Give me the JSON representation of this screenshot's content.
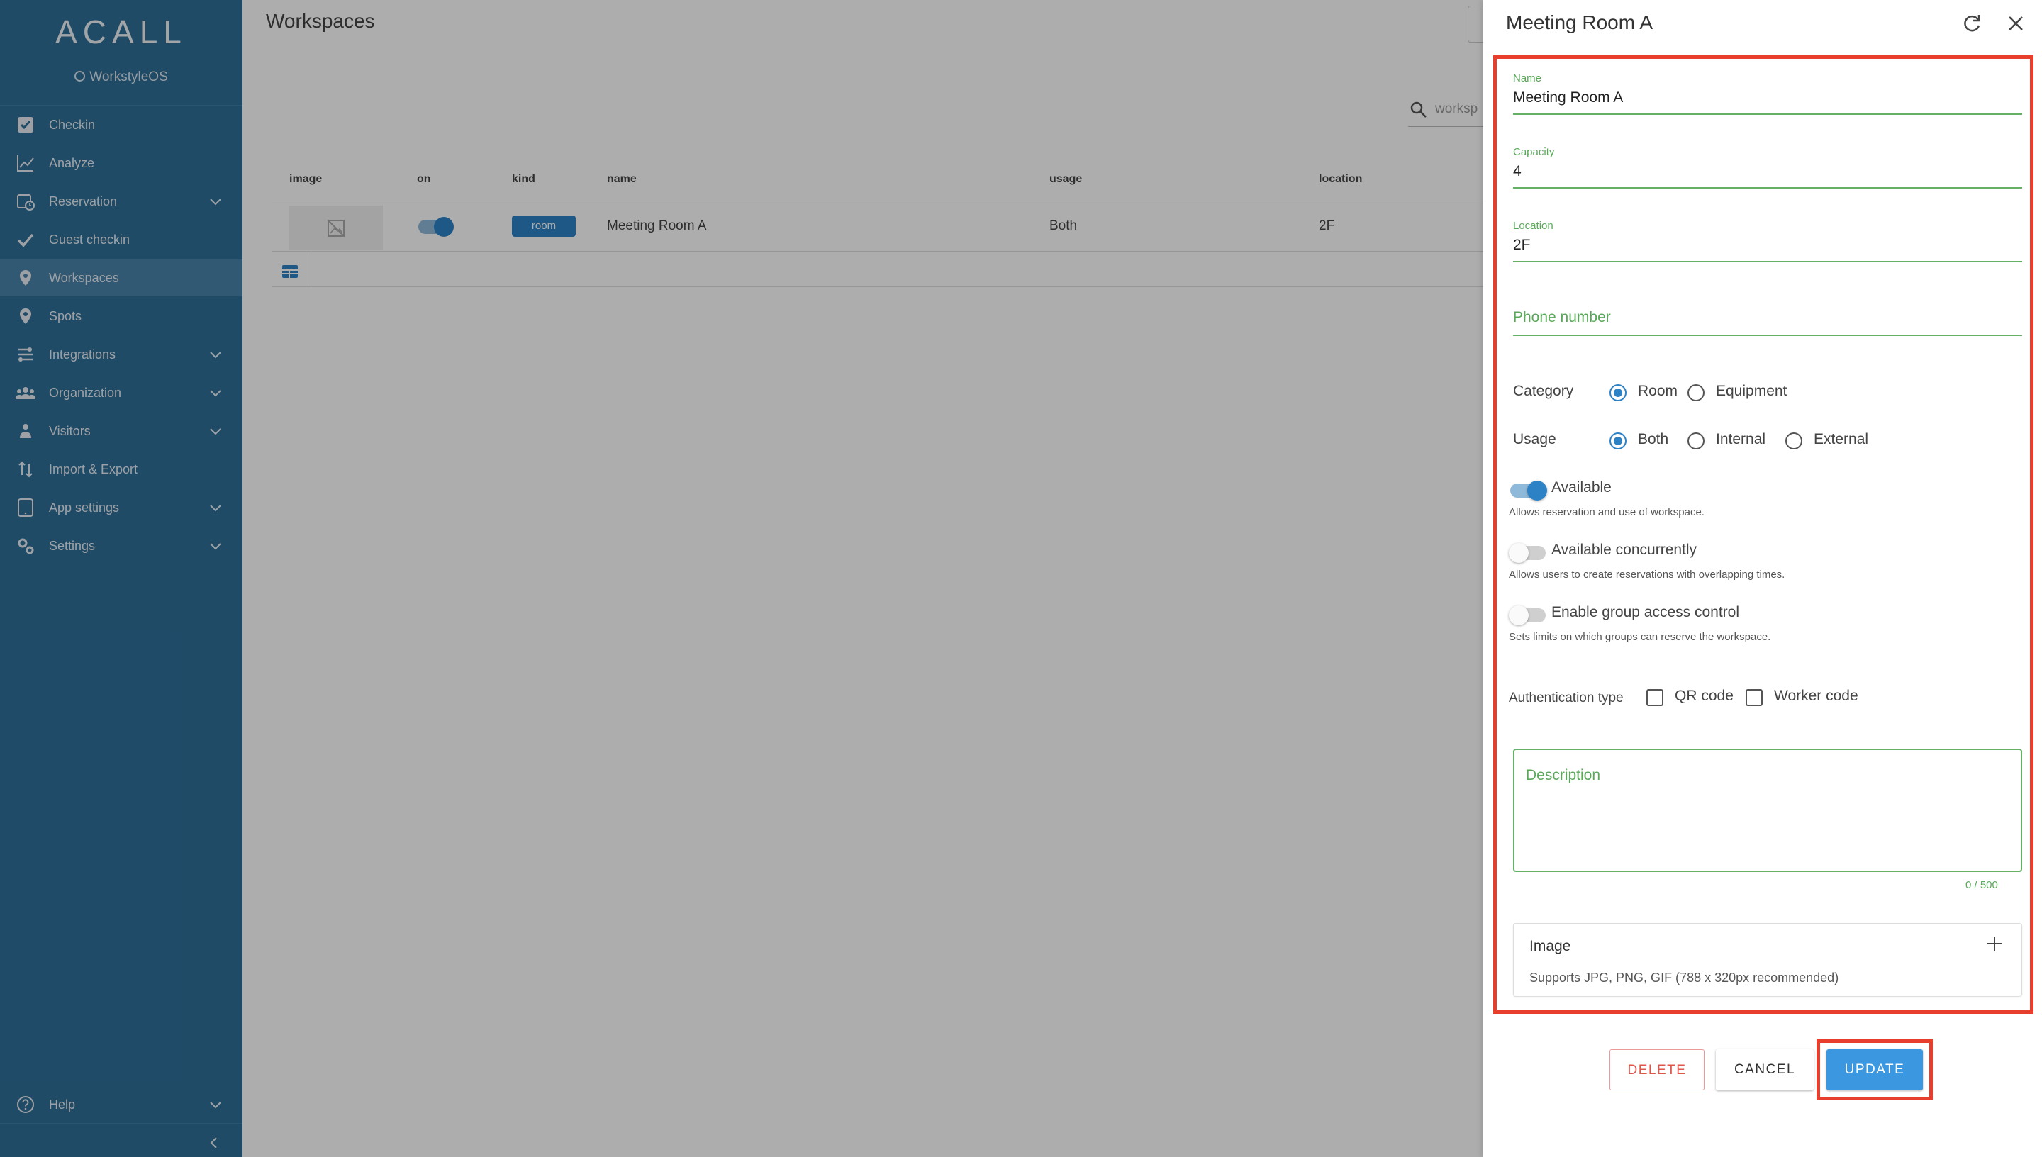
{
  "sidebar": {
    "logo": "ACALL",
    "product": "WorkstyleOS",
    "items": [
      {
        "label": "Checkin",
        "icon": "checkbox-icon",
        "expandable": false,
        "active": false
      },
      {
        "label": "Analyze",
        "icon": "chart-line-icon",
        "expandable": false,
        "active": false
      },
      {
        "label": "Reservation",
        "icon": "calendar-clock-icon",
        "expandable": true,
        "active": false
      },
      {
        "label": "Guest checkin",
        "icon": "check-icon",
        "expandable": false,
        "active": false
      },
      {
        "label": "Workspaces",
        "icon": "map-pin-icon",
        "expandable": false,
        "active": true
      },
      {
        "label": "Spots",
        "icon": "map-pin-dot-icon",
        "expandable": false,
        "active": false
      },
      {
        "label": "Integrations",
        "icon": "integrations-icon",
        "expandable": true,
        "active": false
      },
      {
        "label": "Organization",
        "icon": "people-icon",
        "expandable": true,
        "active": false
      },
      {
        "label": "Visitors",
        "icon": "visitor-icon",
        "expandable": true,
        "active": false
      },
      {
        "label": "Import & Export",
        "icon": "import-export-icon",
        "expandable": false,
        "active": false
      },
      {
        "label": "App settings",
        "icon": "tablet-icon",
        "expandable": true,
        "active": false
      },
      {
        "label": "Settings",
        "icon": "gears-icon",
        "expandable": true,
        "active": false
      }
    ],
    "help": {
      "label": "Help",
      "icon": "help-icon",
      "expandable": true
    }
  },
  "main": {
    "title": "Workspaces",
    "search_value": "worksp",
    "columns": [
      "image",
      "on",
      "kind",
      "name",
      "usage",
      "location"
    ],
    "rows": [
      {
        "image": "no-image-icon",
        "on": true,
        "kind": "room",
        "name": "Meeting Room A",
        "usage": "Both",
        "location": "2F"
      }
    ]
  },
  "drawer": {
    "title": "Meeting Room A",
    "fields": {
      "name": {
        "label": "Name",
        "value": "Meeting Room A"
      },
      "capacity": {
        "label": "Capacity",
        "value": "4"
      },
      "location": {
        "label": "Location",
        "value": "2F"
      },
      "phone": {
        "placeholder": "Phone number",
        "value": ""
      }
    },
    "category": {
      "label": "Category",
      "options": [
        "Room",
        "Equipment"
      ],
      "selected": "Room"
    },
    "usage": {
      "label": "Usage",
      "options": [
        "Both",
        "Internal",
        "External"
      ],
      "selected": "Both"
    },
    "switches": [
      {
        "label": "Available",
        "help": "Allows reservation and use of workspace.",
        "on": true
      },
      {
        "label": "Available concurrently",
        "help": "Allows users to create reservations with overlapping times.",
        "on": false
      },
      {
        "label": "Enable group access control",
        "help": "Sets limits on which groups can reserve the workspace.",
        "on": false
      }
    ],
    "auth": {
      "label": "Authentication type",
      "options": [
        "QR code",
        "Worker code"
      ],
      "checked": []
    },
    "description": {
      "placeholder": "Description",
      "counter": "0 / 500"
    },
    "image": {
      "title": "Image",
      "hint": "Supports JPG, PNG, GIF (788 x 320px recommended)"
    },
    "buttons": {
      "delete": "DELETE",
      "cancel": "CANCEL",
      "update": "UPDATE"
    },
    "colors": {
      "accent": "#2d82c6",
      "field_green": "#5aa85a",
      "highlight_red": "#e83e2d",
      "update_blue": "#3a97e0"
    }
  }
}
